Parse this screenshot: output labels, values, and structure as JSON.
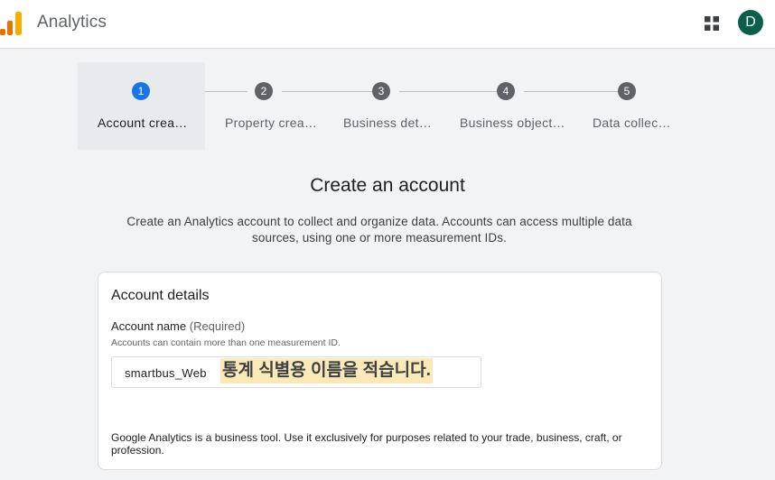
{
  "header": {
    "app_title": "Analytics",
    "logo_icon": "analytics-bars-icon",
    "apps_icon": "grid-apps-icon",
    "avatar_initial": "D",
    "avatar_color": "#0b5f4a"
  },
  "stepper": {
    "steps": [
      {
        "number": "1",
        "label": "Account crea…",
        "active": true
      },
      {
        "number": "2",
        "label": "Property crea…",
        "active": false
      },
      {
        "number": "3",
        "label": "Business det…",
        "active": false
      },
      {
        "number": "4",
        "label": "Business object…",
        "active": false
      },
      {
        "number": "5",
        "label": "Data collec…",
        "active": false
      }
    ]
  },
  "main": {
    "heading": "Create an account",
    "intro": "Create an Analytics account to collect and organize data. Accounts can access multiple data sources, using one or more measurement IDs."
  },
  "card": {
    "title": "Account details",
    "field_label": "Account name",
    "field_required": "(Required)",
    "field_help": "Accounts can contain more than one measurement ID.",
    "field_value": "smartbus_Web",
    "annotation": "통계 식별용 이름을 적습니다.",
    "disclaimer": "Google Analytics is a business tool. Use it exclusively for purposes related to your trade, business, craft, or profession."
  },
  "colors": {
    "accent": "#1a73e8",
    "step_inactive": "#5f6368",
    "annotation_highlight": "#fbe9b8"
  }
}
